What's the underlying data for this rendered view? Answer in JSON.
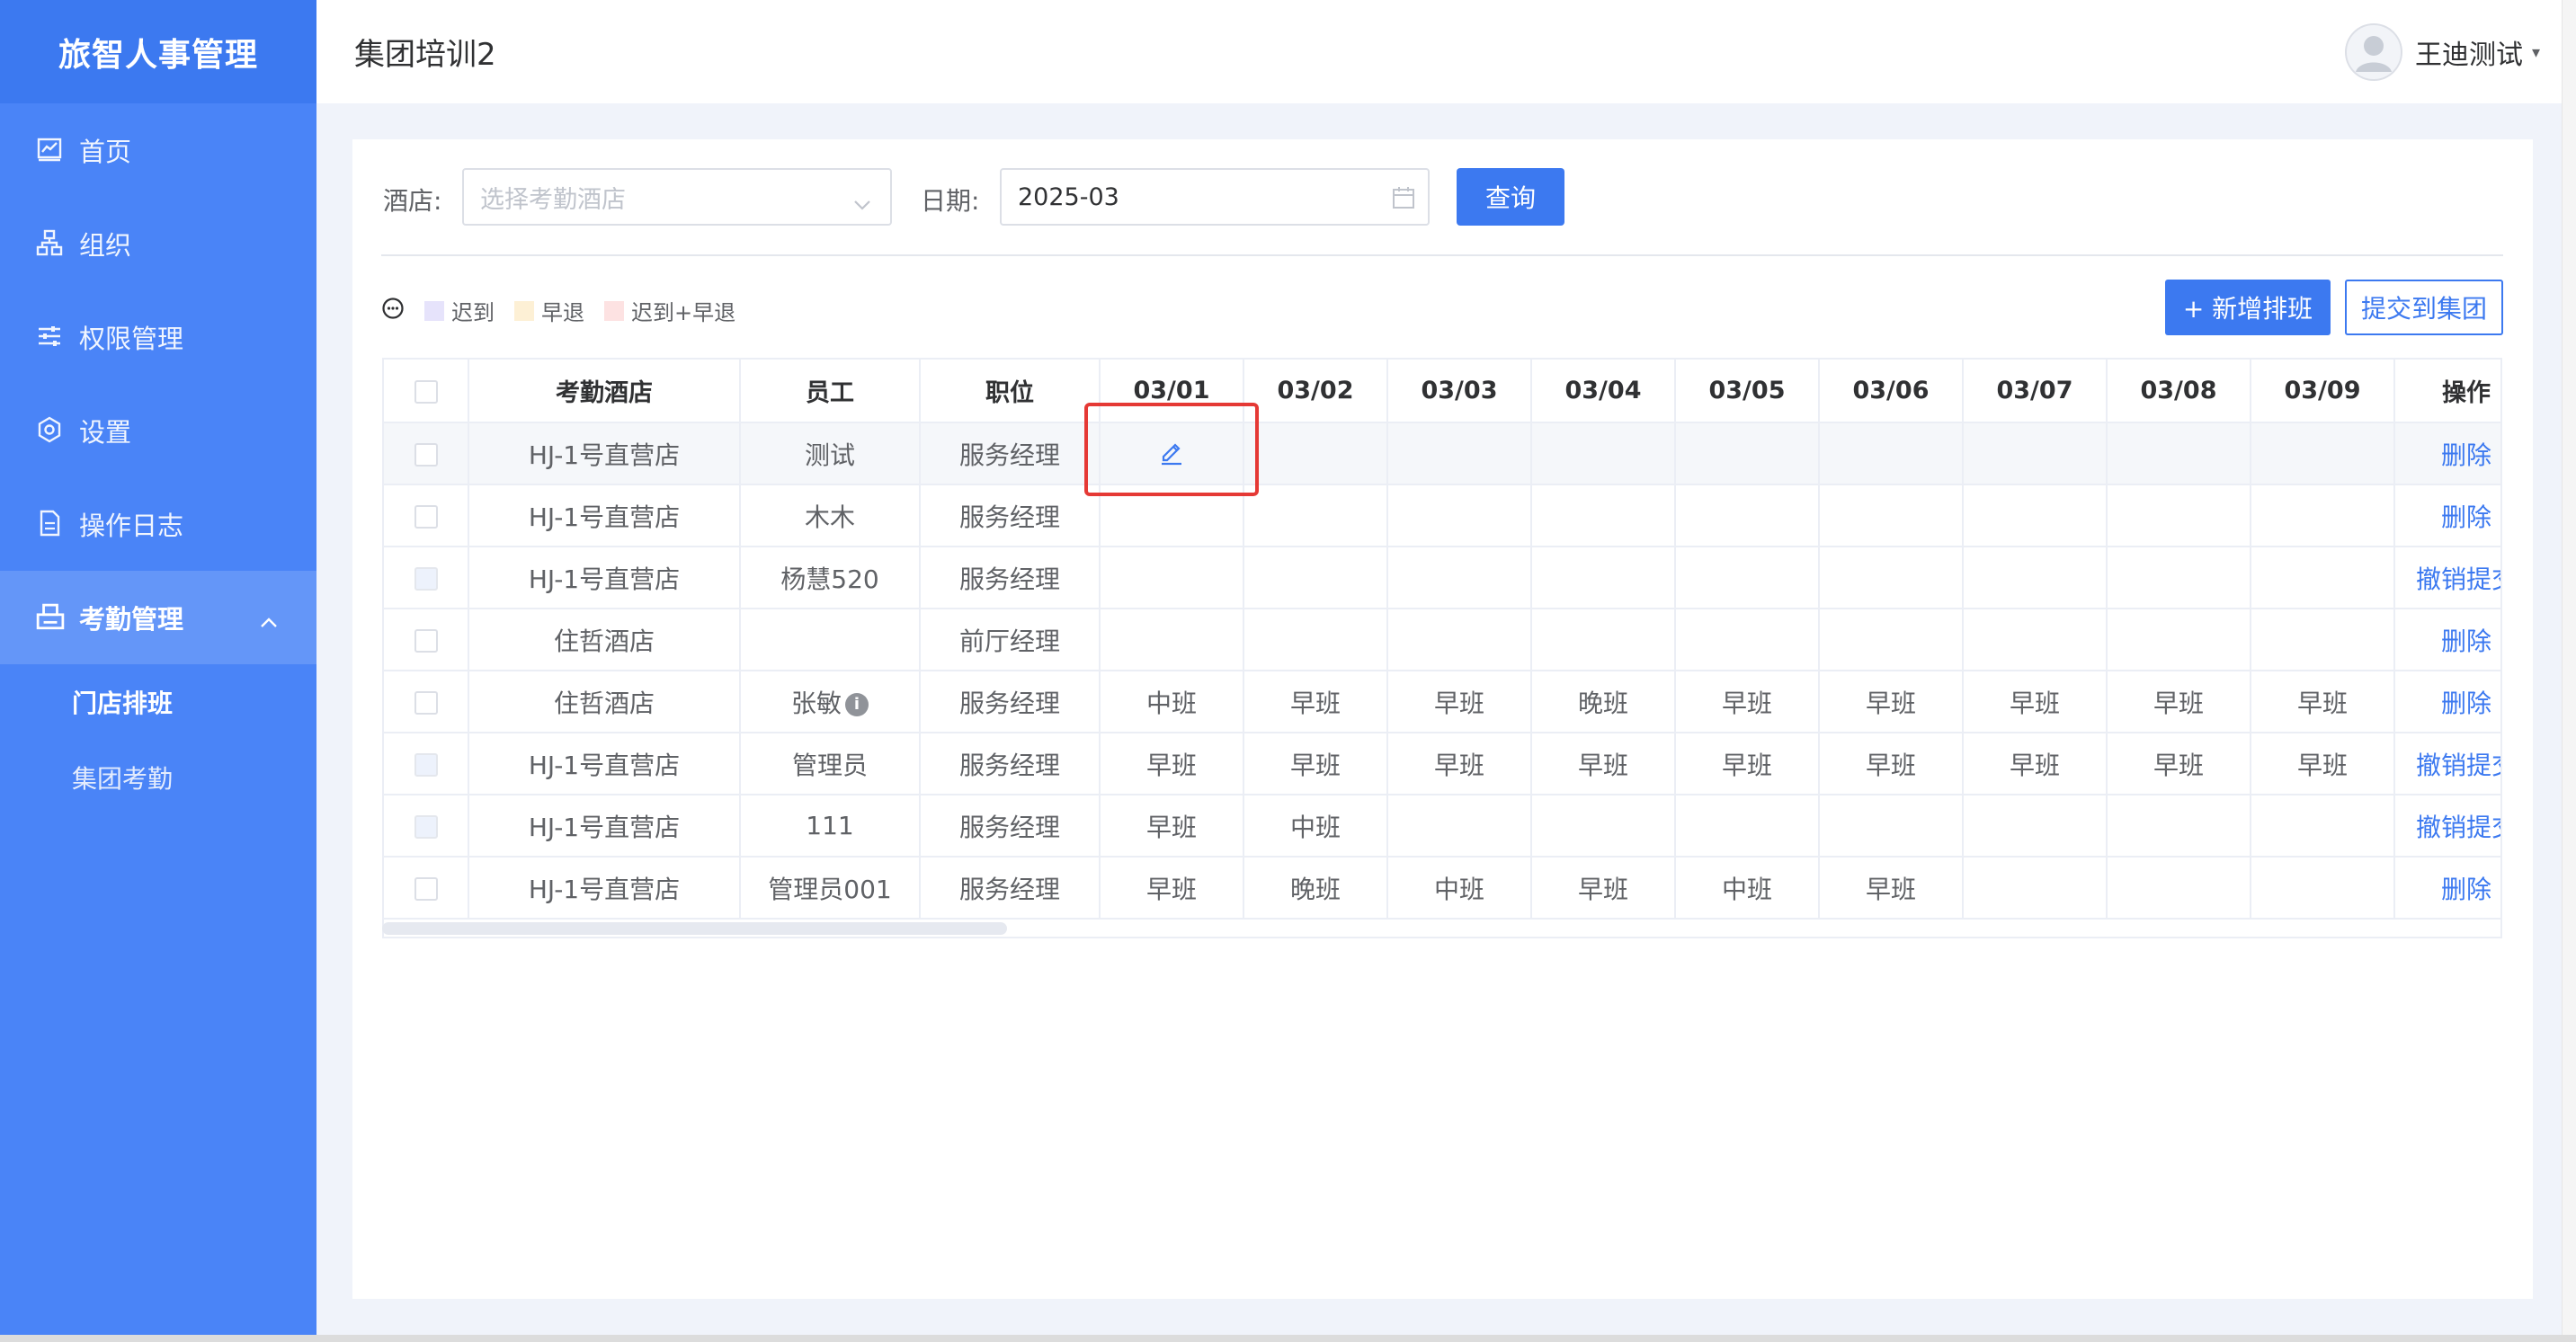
{
  "sidebar": {
    "brand": "旅智人事管理",
    "items": [
      {
        "label": "首页",
        "icon": "chart-icon"
      },
      {
        "label": "组织",
        "icon": "org-tree-icon"
      },
      {
        "label": "权限管理",
        "icon": "sliders-icon"
      },
      {
        "label": "设置",
        "icon": "gear-icon"
      },
      {
        "label": "操作日志",
        "icon": "document-icon"
      },
      {
        "label": "考勤管理",
        "icon": "printer-icon"
      }
    ],
    "subitems": [
      {
        "label": "门店排班"
      },
      {
        "label": "集团考勤"
      }
    ]
  },
  "header": {
    "title": "集团培训2",
    "user_name": "王迪测试"
  },
  "filters": {
    "hotel_label": "酒店:",
    "hotel_placeholder": "选择考勤酒店",
    "date_label": "日期:",
    "date_value": "2025-03",
    "query_label": "查询"
  },
  "legend": [
    {
      "label": "迟到",
      "color": "#e6e3fb"
    },
    {
      "label": "早退",
      "color": "#fdf0d5"
    },
    {
      "label": "迟到+早退",
      "color": "#fde2e2"
    }
  ],
  "actions": {
    "add_label": "+ 新增排班",
    "submit_label": "提交到集团"
  },
  "table": {
    "headers": {
      "hotel": "考勤酒店",
      "employee": "员工",
      "position": "职位",
      "dates": [
        "03/01",
        "03/02",
        "03/03",
        "03/04",
        "03/05",
        "03/06",
        "03/07",
        "03/08",
        "03/09"
      ],
      "op": "操作"
    },
    "rows": [
      {
        "hotel": "HJ-1号直营店",
        "employee": "测试",
        "position": "服务经理",
        "shifts": [
          "",
          "",
          "",
          "",
          "",
          "",
          "",
          "",
          ""
        ],
        "op": "删除",
        "checkbox_disabled": false,
        "info": false,
        "highlight": true,
        "edit_icon": true
      },
      {
        "hotel": "HJ-1号直营店",
        "employee": "木木",
        "position": "服务经理",
        "shifts": [
          "",
          "",
          "",
          "",
          "",
          "",
          "",
          "",
          ""
        ],
        "op": "删除",
        "checkbox_disabled": false,
        "info": false
      },
      {
        "hotel": "HJ-1号直营店",
        "employee": "杨慧520",
        "position": "服务经理",
        "shifts": [
          "",
          "",
          "",
          "",
          "",
          "",
          "",
          "",
          ""
        ],
        "op": "撤销提交",
        "checkbox_disabled": true,
        "info": false
      },
      {
        "hotel": "住哲酒店",
        "employee": "",
        "position": "前厅经理",
        "shifts": [
          "",
          "",
          "",
          "",
          "",
          "",
          "",
          "",
          ""
        ],
        "op": "删除",
        "checkbox_disabled": false,
        "info": false
      },
      {
        "hotel": "住哲酒店",
        "employee": "张敏",
        "position": "服务经理",
        "shifts": [
          "中班",
          "早班",
          "早班",
          "晚班",
          "早班",
          "早班",
          "早班",
          "早班",
          "早班"
        ],
        "op": "删除",
        "checkbox_disabled": false,
        "info": true
      },
      {
        "hotel": "HJ-1号直营店",
        "employee": "管理员",
        "position": "服务经理",
        "shifts": [
          "早班",
          "早班",
          "早班",
          "早班",
          "早班",
          "早班",
          "早班",
          "早班",
          "早班"
        ],
        "op": "撤销提交",
        "checkbox_disabled": true,
        "info": false
      },
      {
        "hotel": "HJ-1号直营店",
        "employee": "111",
        "position": "服务经理",
        "shifts": [
          "早班",
          "中班",
          "",
          "",
          "",
          "",
          "",
          "",
          ""
        ],
        "op": "撤销提交",
        "checkbox_disabled": true,
        "info": false
      },
      {
        "hotel": "HJ-1号直营店",
        "employee": "管理员001",
        "position": "服务经理",
        "shifts": [
          "早班",
          "晚班",
          "中班",
          "早班",
          "中班",
          "早班",
          "",
          "",
          ""
        ],
        "op": "删除",
        "checkbox_disabled": false,
        "info": false
      }
    ]
  },
  "colors": {
    "accent": "#3c79f0",
    "sidebar": "#4a84f7",
    "highlight_border": "#e53935"
  }
}
